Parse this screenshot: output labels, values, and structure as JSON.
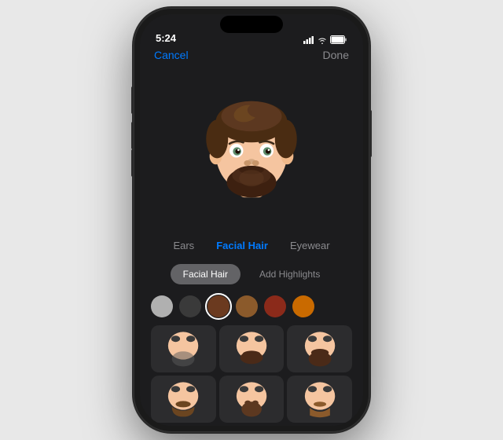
{
  "status_bar": {
    "time": "5:24",
    "battery": "100"
  },
  "nav": {
    "cancel": "Cancel",
    "done": "Done"
  },
  "main_tabs": [
    {
      "id": "ears",
      "label": "Ears",
      "active": false
    },
    {
      "id": "facial-hair",
      "label": "Facial Hair",
      "active": true
    },
    {
      "id": "eyewear",
      "label": "Eyewear",
      "active": false
    }
  ],
  "sub_tabs": [
    {
      "id": "facial-hair-sub",
      "label": "Facial Hair",
      "active": true
    },
    {
      "id": "add-highlights",
      "label": "Add Highlights",
      "active": false
    }
  ],
  "color_swatches": [
    {
      "id": "gray",
      "color": "#b0b0b0",
      "selected": false
    },
    {
      "id": "dark-gray",
      "color": "#3a3a3a",
      "selected": false
    },
    {
      "id": "brown",
      "color": "#6b3a1f",
      "selected": true
    },
    {
      "id": "medium-brown",
      "color": "#8b5a2b",
      "selected": false
    },
    {
      "id": "dark-red",
      "color": "#8b2a1a",
      "selected": false
    },
    {
      "id": "orange",
      "color": "#c96a00",
      "selected": false
    }
  ]
}
